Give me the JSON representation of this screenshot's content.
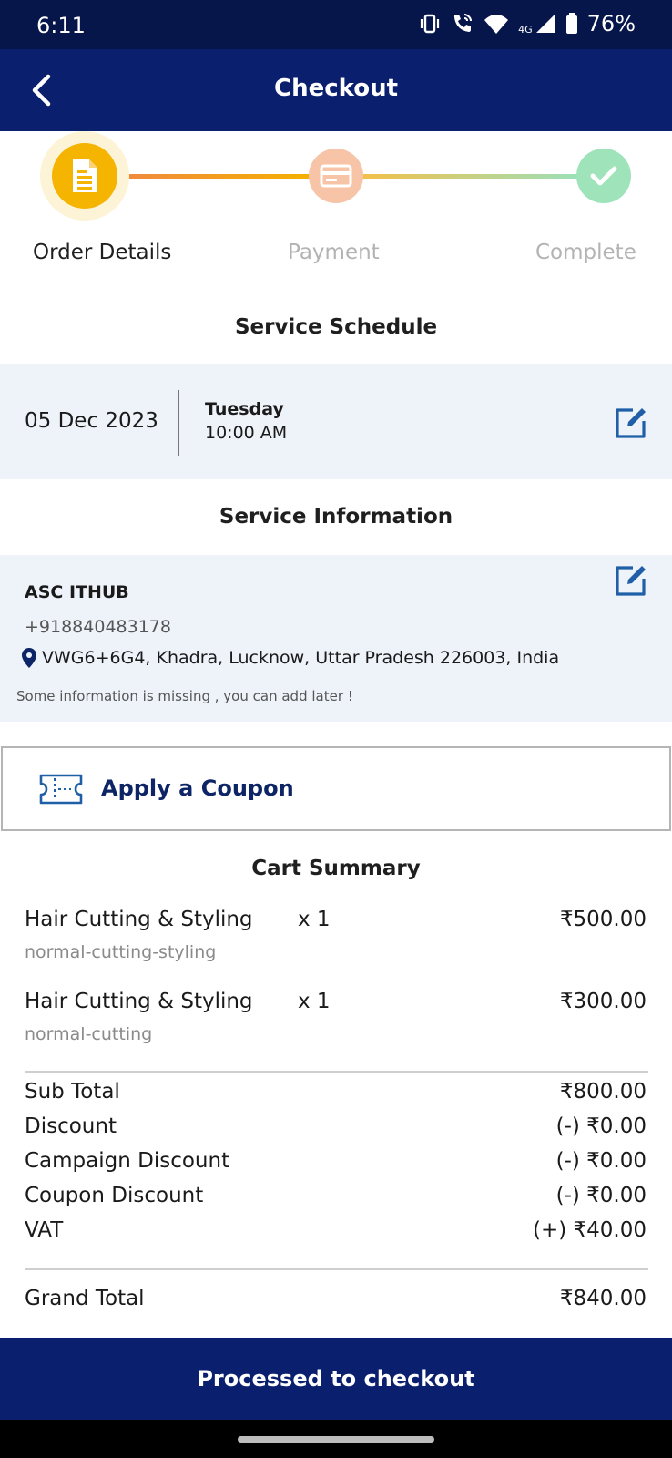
{
  "status_bar": {
    "time": "6:11",
    "network": "4G",
    "battery": "76%"
  },
  "app_bar": {
    "title": "Checkout",
    "back_icon": "chevron-left-icon"
  },
  "stepper": {
    "steps": [
      {
        "label": "Order Details",
        "icon": "document-icon",
        "state": "active"
      },
      {
        "label": "Payment",
        "icon": "card-icon",
        "state": "pending"
      },
      {
        "label": "Complete",
        "icon": "check-icon",
        "state": "pending"
      }
    ],
    "colors": {
      "active": "#f5b400",
      "payment": "#f7c4a7",
      "complete": "#9ee3b9",
      "inactive_text": "#b3b3b3"
    }
  },
  "schedule": {
    "title": "Service Schedule",
    "date": "05 Dec 2023",
    "day": "Tuesday",
    "time": "10:00 AM"
  },
  "service_info": {
    "title": "Service Information",
    "name": "ASC ITHUB",
    "phone": "+918840483178",
    "address": "VWG6+6G4, Khadra, Lucknow, Uttar Pradesh 226003, India",
    "note": "Some information is missing , you can add later !"
  },
  "coupon": {
    "label": "Apply a Coupon"
  },
  "cart": {
    "title": "Cart Summary",
    "items": [
      {
        "name": "Hair Cutting & Styling",
        "variant": "normal-cutting-styling",
        "qty": "x 1",
        "price": "₹500.00"
      },
      {
        "name": "Hair Cutting & Styling",
        "variant": "normal-cutting",
        "qty": "x 1",
        "price": "₹300.00"
      }
    ],
    "summary": [
      {
        "label": "Sub Total",
        "value": "₹800.00"
      },
      {
        "label": "Discount",
        "value": "(-) ₹0.00"
      },
      {
        "label": "Campaign Discount",
        "value": "(-) ₹0.00"
      },
      {
        "label": "Coupon Discount",
        "value": "(-) ₹0.00"
      },
      {
        "label": "VAT",
        "value": "(+) ₹40.00"
      }
    ],
    "grand_total": {
      "label": "Grand Total",
      "value": "₹840.00"
    }
  },
  "checkout_button": {
    "label": "Processed to checkout"
  },
  "theme": {
    "primary": "#0a1f6e",
    "status_bar": "#06154a",
    "panel_bg": "#eef3fa",
    "accent_blue": "#1f5fa8"
  }
}
